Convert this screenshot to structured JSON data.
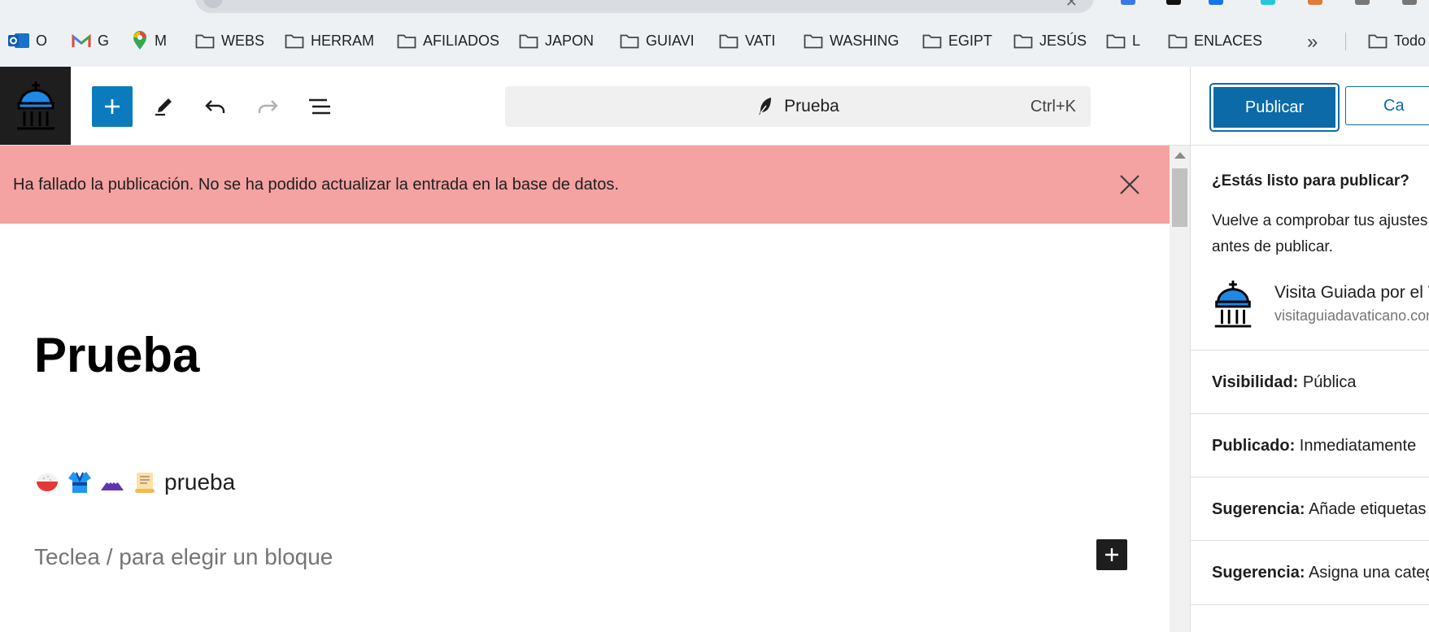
{
  "browser": {
    "bookmarks": [
      {
        "label": "O",
        "icon": "outlook-icon"
      },
      {
        "label": "G",
        "icon": "gmail-icon"
      },
      {
        "label": "M",
        "icon": "maps-icon"
      },
      {
        "label": "WEBS",
        "icon": "folder-icon"
      },
      {
        "label": "HERRAM",
        "icon": "folder-icon"
      },
      {
        "label": "AFILIADOS",
        "icon": "folder-icon"
      },
      {
        "label": "JAPON",
        "icon": "folder-icon"
      },
      {
        "label": "GUIAVI",
        "icon": "folder-icon"
      },
      {
        "label": "VATI",
        "icon": "folder-icon"
      },
      {
        "label": "WASHING",
        "icon": "folder-icon"
      },
      {
        "label": "EGIPT",
        "icon": "folder-icon"
      },
      {
        "label": "JESÚS",
        "icon": "folder-icon"
      },
      {
        "label": "L",
        "icon": "folder-icon"
      },
      {
        "label": "ENLACES",
        "icon": "folder-icon"
      }
    ],
    "more_label": "»",
    "all_bookmarks_label": "Todo"
  },
  "toolbar": {
    "command_title": "Prueba",
    "command_shortcut": "Ctrl+K"
  },
  "notice": {
    "text": "Ha fallado la publicación. No se ha podido actualizar la entrada en la base de datos."
  },
  "editor": {
    "title": "Prueba",
    "paragraph_text": "prueba",
    "emojis": [
      "rice-bowl-emoji",
      "kimono-emoji",
      "mount-fuji-emoji",
      "scroll-emoji"
    ],
    "placeholder": "Teclea / para elegir un bloque"
  },
  "sidebar": {
    "publish_label": "Publicar",
    "cancel_label": "Ca",
    "question": "¿Estás listo para publicar?",
    "description": "Vuelve a comprobar tus ajustes antes de publicar.",
    "site_name": "Visita Guiada por el Vaticano",
    "site_url": "visitaguiadavaticano.com",
    "visibility_label": "Visibilidad:",
    "visibility_value": "Pública",
    "published_label": "Publicado:",
    "published_value": "Inmediatamente",
    "suggestion_label": "Sugerencia:",
    "suggestion_tags": "Añade etiquetas",
    "suggestion_category": "Asigna una categoría"
  },
  "colors": {
    "accent": "#0c7bbd",
    "notice_bg": "#f4a2a2",
    "dark": "#1e1e1e"
  }
}
